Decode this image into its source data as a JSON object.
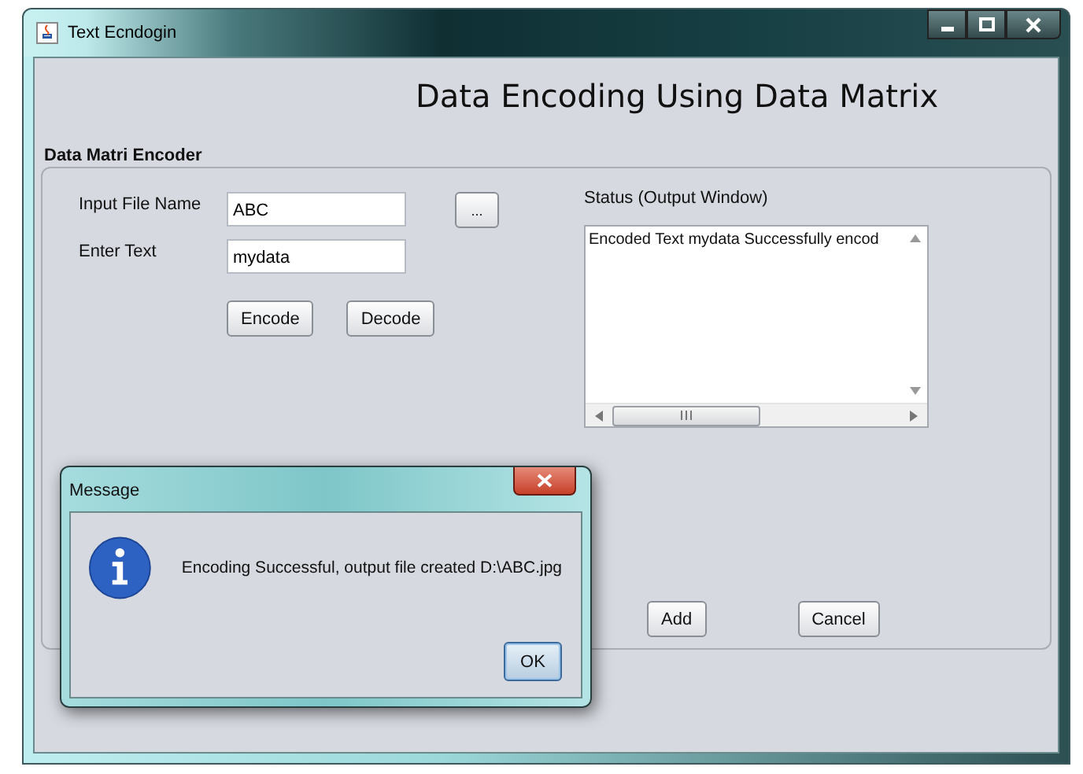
{
  "window": {
    "title": "Text Ecndogin"
  },
  "heading": "Data Encoding Using Data Matrix",
  "group": {
    "label": "Data Matri Encoder"
  },
  "fields": [
    {
      "label": "Input File Name",
      "value": "ABC",
      "button": "..."
    },
    {
      "label": "Enter Text",
      "value": "mydata"
    }
  ],
  "action_buttons": [
    "Encode",
    "Decode"
  ],
  "status": {
    "label": "Status (Output Window)",
    "text": "Encoded Text mydata Successfully encod"
  },
  "bottom_buttons": [
    "Add",
    "Cancel"
  ],
  "dialog": {
    "title": "Message",
    "message": "Encoding Successful, output file created D:\\ABC.jpg",
    "button": "OK"
  }
}
